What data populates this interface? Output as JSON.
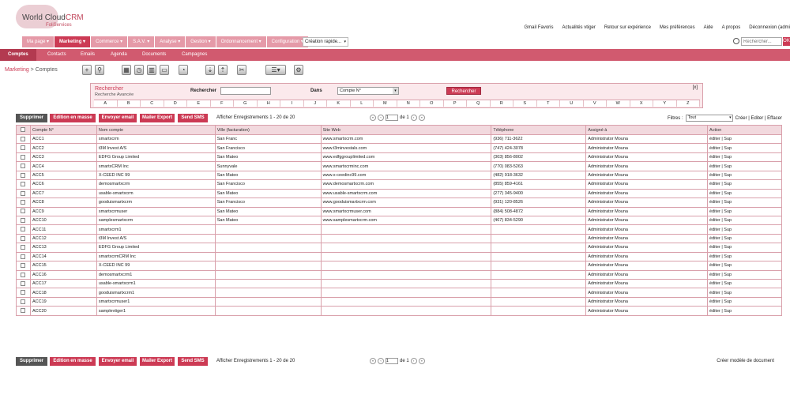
{
  "logo": {
    "main": "World Cloud",
    "accent": "CRM",
    "tagline": "FoliServices"
  },
  "top_links": [
    "Gmail Favoris",
    "Actualités vtiger",
    "Retour sur expérience",
    "Mes préférences",
    "Aide",
    "A propos",
    "Déconnexion (admi"
  ],
  "menu": [
    {
      "label": "Ma page ▾",
      "active": false
    },
    {
      "label": "Marketing ▾",
      "active": true
    },
    {
      "label": "Commerce ▾",
      "active": false
    },
    {
      "label": "S.A.V. ▾",
      "active": false
    },
    {
      "label": "Analyse ▾",
      "active": false
    },
    {
      "label": "Gestion ▾",
      "active": false
    },
    {
      "label": "Ordonnancement ▾",
      "active": false
    },
    {
      "label": "Configuration ▾",
      "active": false
    }
  ],
  "quick_create": "Création rapide...",
  "search_placeholder": "Rechercher...",
  "search_go": "OK",
  "subnav": [
    "Comptes",
    "Contacts",
    "Emails",
    "Agenda",
    "Documents",
    "Campagnes"
  ],
  "breadcrumb": {
    "module": "Marketing",
    "sep": " > ",
    "page": "Comptes"
  },
  "search_panel": {
    "title": "Rechercher",
    "advanced": "Recherche Avancée",
    "label_search": "Rechercher",
    "label_in": "Dans",
    "field": "Compte N°",
    "button": "Rechercher",
    "close": "[x]",
    "letters": [
      "A",
      "B",
      "C",
      "D",
      "E",
      "F",
      "G",
      "H",
      "I",
      "J",
      "K",
      "L",
      "M",
      "N",
      "O",
      "P",
      "Q",
      "R",
      "S",
      "T",
      "U",
      "V",
      "W",
      "X",
      "Y",
      "Z"
    ]
  },
  "actions": {
    "delete": "Supprimer",
    "mass_edit": "Edition en masse",
    "send_email": "Envoyer email",
    "mailer_export": "Mailer Export",
    "send_sms": "Send SMS",
    "records": "Afficher Enregistrements 1 - 20 de 20",
    "page": "1",
    "of": "de 1",
    "filters_label": "Filtres :",
    "filter_value": "Tout",
    "filter_links": "Créer | Editer | Effacer",
    "create_template": "Créer modèle de document"
  },
  "columns": [
    "Compte N°",
    "Nom compte",
    "Ville (facturation)",
    "Site Web",
    "Téléphone",
    "Assigné à",
    "Action"
  ],
  "rows": [
    [
      "ACC1",
      "smartxcrm",
      "San Franc",
      "www.smartxcrm.com",
      "(936) 711-3622",
      "Administrator Mouna",
      "éditer | Sup"
    ],
    [
      "ACC2",
      "t3M Invest A/S",
      "San Francisco",
      "www.t3minvestals.com",
      "(747) 424-3078",
      "Administrator Mouna",
      "éditer | Sup"
    ],
    [
      "ACC3",
      "EDFG Group Limited",
      "San Mateo",
      "www.edfggrouplimited.com",
      "(303) 856-8002",
      "Administrator Mouna",
      "éditer | Sup"
    ],
    [
      "ACC4",
      "smartxCRM Inc",
      "Sunnyvale",
      "www.smartxcrminc.com",
      "(770) 083-5263",
      "Administrator Mouna",
      "éditer | Sup"
    ],
    [
      "ACC5",
      "X-CEED INC 99",
      "San Mateo",
      "www.x-ceedinc99.com",
      "(482) 918-3632",
      "Administrator Mouna",
      "éditer | Sup"
    ],
    [
      "ACC6",
      "demosmartxcrm",
      "San Francisco",
      "www.demosmartxcrm.com",
      "(855) 859-4161",
      "Administrator Mouna",
      "éditer | Sup"
    ],
    [
      "ACC7",
      "usable-smartxcrm",
      "San Mateo",
      "www.usable-smartxcrm.com",
      "(277) 345-9400",
      "Administrator Mouna",
      "éditer | Sup"
    ],
    [
      "ACC8",
      "gooduismartxcrm",
      "San Francisco",
      "www.gooduismartxcrm.com",
      "(931) 120-8526",
      "Administrator Mouna",
      "éditer | Sup"
    ],
    [
      "ACC9",
      "smartxcrmuser",
      "San Mateo",
      "www.smartxcrmuser.com",
      "(884) 508-4872",
      "Administrator Mouna",
      "éditer | Sup"
    ],
    [
      "ACC10",
      "samplesmartxcrm",
      "San Mateo",
      "www.samplesmartxcrm.com",
      "(467) 834-5290",
      "Administrator Mouna",
      "éditer | Sup"
    ],
    [
      "ACC11",
      "smartxcrm1",
      "",
      "",
      "",
      "Administrator Mouna",
      "éditer | Sup"
    ],
    [
      "ACC12",
      "t3M Invest A/S",
      "",
      "",
      "",
      "Administrator Mouna",
      "éditer | Sup"
    ],
    [
      "ACC13",
      "EDFG Group Limited",
      "",
      "",
      "",
      "Administrator Mouna",
      "éditer | Sup"
    ],
    [
      "ACC14",
      "smartxcrmCRM Inc",
      "",
      "",
      "",
      "Administrator Mouna",
      "éditer | Sup"
    ],
    [
      "ACC15",
      "X-CEED INC 99",
      "",
      "",
      "",
      "Administrator Mouna",
      "éditer | Sup"
    ],
    [
      "ACC16",
      "demosmartxcrm1",
      "",
      "",
      "",
      "Administrator Mouna",
      "éditer | Sup"
    ],
    [
      "ACC17",
      "usable-smartxcrm1",
      "",
      "",
      "",
      "Administrator Mouna",
      "éditer | Sup"
    ],
    [
      "ACC18",
      "gooduismartxcrm1",
      "",
      "",
      "",
      "Administrator Mouna",
      "éditer | Sup"
    ],
    [
      "ACC19",
      "smartxcrmuser1",
      "",
      "",
      "",
      "Administrator Mouna",
      "éditer | Sup"
    ],
    [
      "ACC20",
      "samplevtiger1",
      "",
      "",
      "",
      "Administrator Mouna",
      "éditer | Sup"
    ]
  ],
  "colors": {
    "accent": "#cc3a54",
    "menu": "#e59aa8",
    "subnav": "#d15a6f",
    "grid_border": "#d9a0ab"
  }
}
